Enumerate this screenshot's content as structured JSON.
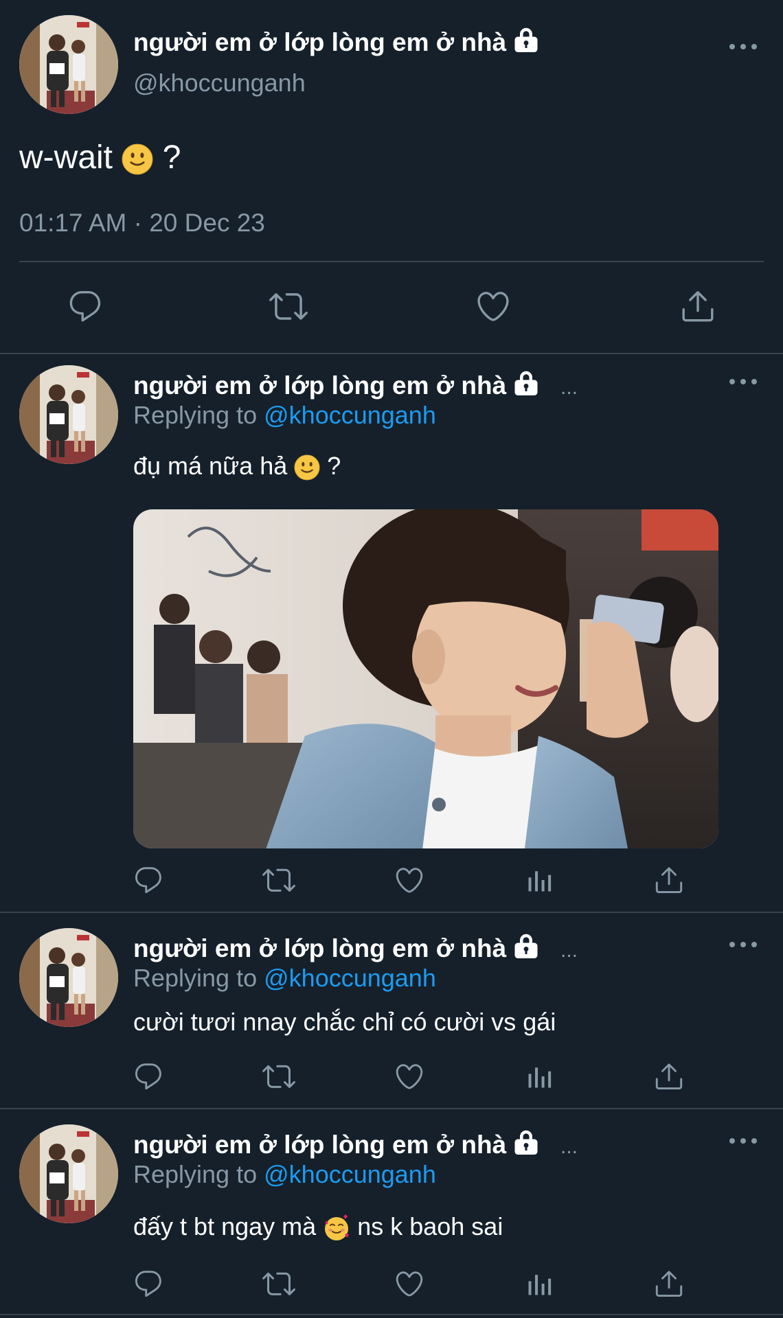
{
  "main_tweet": {
    "display_name": "người em ở lớp lòng em ở nhà",
    "handle": "@khoccunganh",
    "text_before": "w-wait",
    "text_after": "?",
    "timestamp": "01:17 AM · 20 Dec 23",
    "actions": [
      "reply-icon",
      "retweet-icon",
      "like-icon",
      "share-icon"
    ]
  },
  "replies": [
    {
      "display_name": "người em ở lớp lòng em ở nhà",
      "trail": "...",
      "replying_prefix": "Replying to",
      "replying_handle": "@khoccunganh",
      "text_before": "đụ má nữa hả",
      "text_after": "?",
      "has_media": true,
      "actions": [
        "reply-icon",
        "retweet-icon",
        "like-icon",
        "analytics-icon",
        "share-icon"
      ]
    },
    {
      "display_name": "người em ở lớp lòng em ở nhà",
      "trail": "...",
      "replying_prefix": "Replying to",
      "replying_handle": "@khoccunganh",
      "text_before": "cười tươi nnay chắc chỉ có cười vs gái",
      "text_after": "",
      "has_media": false,
      "actions": [
        "reply-icon",
        "retweet-icon",
        "like-icon",
        "analytics-icon",
        "share-icon"
      ]
    },
    {
      "display_name": "người em ở lớp lòng em ở nhà",
      "trail": "...",
      "replying_prefix": "Replying to",
      "replying_handle": "@khoccunganh",
      "text_before": "đấy t bt ngay mà",
      "text_after": "ns k baoh sai",
      "has_media": false,
      "actions": [
        "reply-icon",
        "retweet-icon",
        "like-icon",
        "analytics-icon",
        "share-icon"
      ]
    }
  ],
  "colors": {
    "background": "#15202b",
    "secondary_text": "#8899a6",
    "link": "#1d9bf0",
    "divider": "#38444d"
  }
}
